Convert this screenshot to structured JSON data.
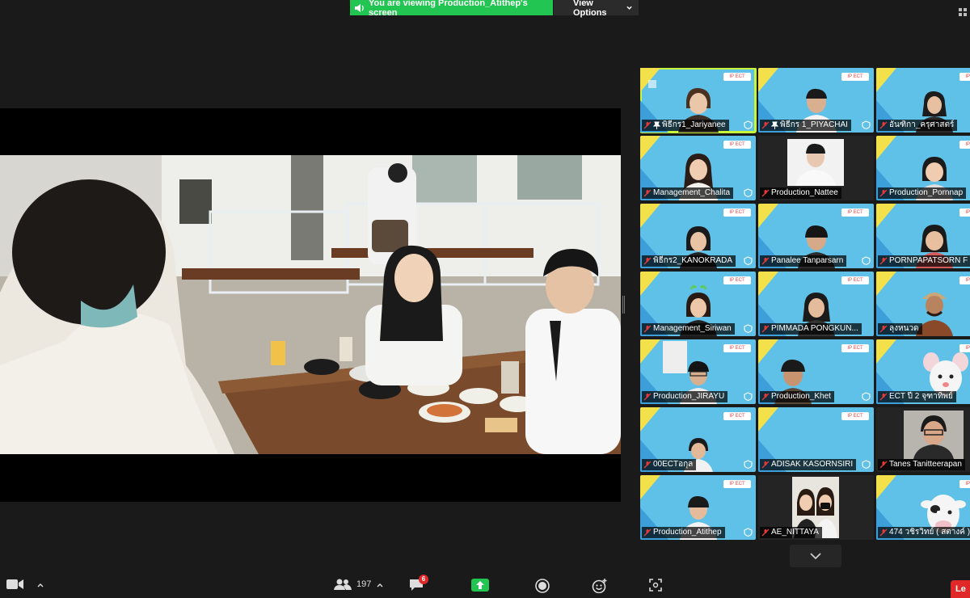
{
  "banner": {
    "sharing_text": "You are viewing Production_Atithep's screen",
    "view_options_label": "View Options"
  },
  "colors": {
    "banner_green": "#23c552",
    "active_speaker": "#c6f53a",
    "tile_blue": "#5fc0e8",
    "leave_red": "#e02828"
  },
  "gallery": {
    "tiles": [
      {
        "name": "พิธีกร1_Jariyanee",
        "pinned": true
      },
      {
        "name": "พิธีกร 1_PIYACHAI",
        "pinned": true
      },
      {
        "name": "อันฑิกา_ครุศาสตร์",
        "pinned": false
      },
      {
        "name": "Management_Chalita",
        "pinned": false
      },
      {
        "name": "Production_Nattee",
        "pinned": false
      },
      {
        "name": "Production_Pornnap",
        "pinned": false
      },
      {
        "name": "พิธีกร2_KANOKRADA",
        "pinned": false
      },
      {
        "name": "Panalee Tanparsarn",
        "pinned": false
      },
      {
        "name": "PORNPAPATSORN F",
        "pinned": false
      },
      {
        "name": "Management_Siriwan",
        "pinned": false
      },
      {
        "name": "PIMMADA PONGKUN...",
        "pinned": false
      },
      {
        "name": "ลุงหนวด",
        "pinned": false
      },
      {
        "name": "Production_JIRAYU",
        "pinned": false
      },
      {
        "name": "Production_Khet",
        "pinned": false
      },
      {
        "name": "ECT ปี 2 จุฑาทิพย์",
        "pinned": false
      },
      {
        "name": "00ECTอกุล",
        "pinned": false
      },
      {
        "name": "ADISAK KASORNSIRI",
        "pinned": false
      },
      {
        "name": "Tanes Tanitteerapan",
        "pinned": false
      },
      {
        "name": "Production_Atithep",
        "pinned": false
      },
      {
        "name": "AE_NITTAYA",
        "pinned": false
      },
      {
        "name": "474 วชิรวิทย์ ( สตางค์ )",
        "pinned": false
      }
    ]
  },
  "toolbar": {
    "participants_count": "197",
    "chat_badge": "6",
    "leave_label": "Le"
  }
}
